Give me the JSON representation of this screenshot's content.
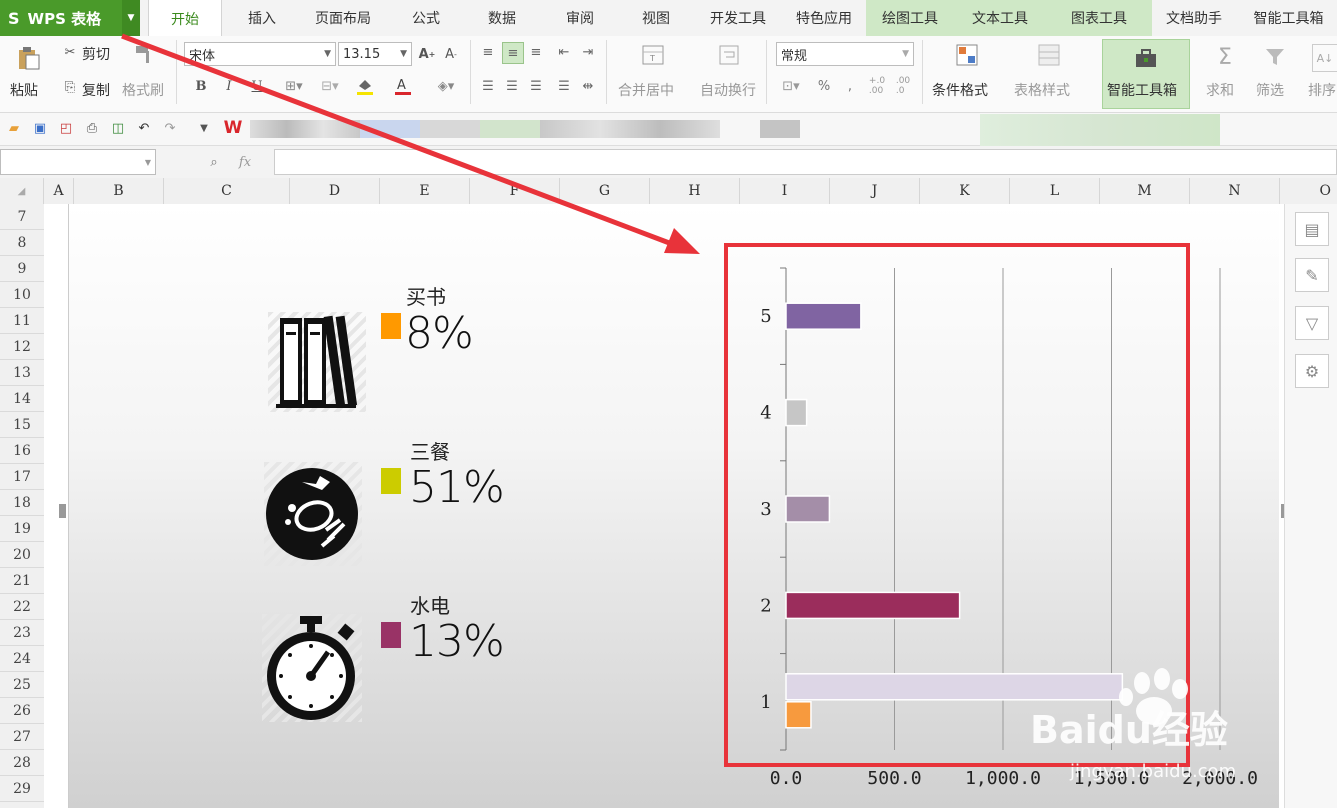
{
  "app": {
    "title": "WPS 表格"
  },
  "tabs": [
    "开始",
    "插入",
    "页面布局",
    "公式",
    "数据",
    "审阅",
    "视图",
    "开发工具",
    "特色应用",
    "绘图工具",
    "文本工具",
    "图表工具",
    "文档助手",
    "智能工具箱"
  ],
  "active_tab": "开始",
  "ribbon": {
    "cut": "剪切",
    "copy": "复制",
    "paste": "粘贴",
    "format_painter": "格式刷",
    "font_name": "宋体",
    "font_size": "13.15",
    "bold": "B",
    "italic": "I",
    "underline": "U",
    "merge_center": "合并居中",
    "wrap_text": "自动换行",
    "number_format": "常规",
    "percent": "%",
    "thousands": ",",
    "cond_format": "条件格式",
    "table_style": "表格样式",
    "smart_toolbox": "智能工具箱",
    "sum": "求和",
    "filter": "筛选",
    "sort": "排序"
  },
  "formula_bar": {
    "name_box": "",
    "fx": "fx",
    "formula": ""
  },
  "columns": [
    "A",
    "B",
    "C",
    "D",
    "E",
    "F",
    "G",
    "H",
    "I",
    "J",
    "K",
    "L",
    "M",
    "N",
    "O"
  ],
  "rows": [
    "7",
    "8",
    "9",
    "10",
    "11",
    "12",
    "13",
    "14",
    "15",
    "16",
    "17",
    "18",
    "19",
    "20",
    "21",
    "22",
    "23",
    "24",
    "25",
    "26",
    "27",
    "28",
    "29"
  ],
  "infographic": {
    "items": [
      {
        "label": "买书",
        "percent": "8%",
        "color": "#ff9900"
      },
      {
        "label": "三餐",
        "percent": "51%",
        "color": "#cccc00"
      },
      {
        "label": "水电",
        "percent": "13%",
        "color": "#993366"
      }
    ]
  },
  "chart_data": {
    "type": "bar",
    "orientation": "horizontal",
    "categories": [
      "1",
      "2",
      "3",
      "4",
      "5"
    ],
    "bars": [
      {
        "category": "1",
        "value": 1550,
        "color": "#ddd6e6"
      },
      {
        "category": "1",
        "value": 115,
        "color": "#f79a3e"
      },
      {
        "category": "2",
        "value": 800,
        "color": "#9b2d5c"
      },
      {
        "category": "3",
        "value": 200,
        "color": "#a48ea8"
      },
      {
        "category": "4",
        "value": 95,
        "color": "#c6c6c6"
      },
      {
        "category": "5",
        "value": 345,
        "color": "#8064a2"
      }
    ],
    "x_ticks": [
      "0.0",
      "500.0",
      "1,000.0",
      "1,500.0",
      "2,000.0"
    ],
    "xlim": [
      0,
      2000
    ],
    "grid": true
  },
  "watermark": {
    "brand": "Baidu经验",
    "url": "jingyan.baidu.com"
  }
}
